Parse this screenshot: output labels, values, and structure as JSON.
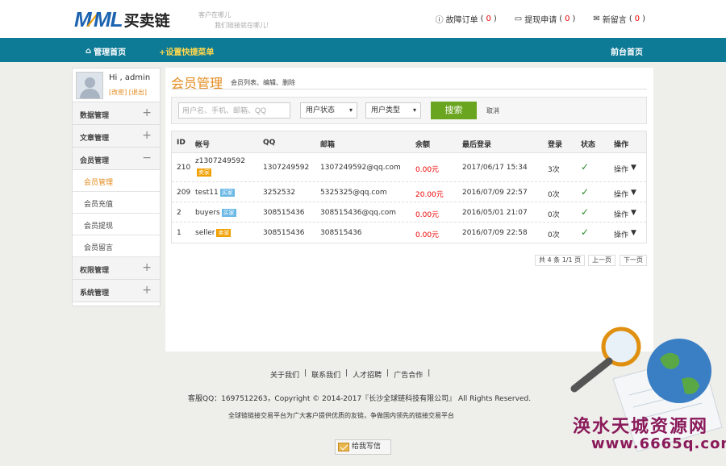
{
  "header": {
    "logo_mark_1": "M",
    "logo_mark_l": "L",
    "logo_mark_2": "ML",
    "logo_text": "买卖链",
    "slogan_line1": "客户在哪儿",
    "slogan_line2": "我们链接就在哪儿!",
    "links": [
      {
        "label": "故障订单",
        "count": "0",
        "icon": "info-icon"
      },
      {
        "label": "提现申请",
        "count": "0",
        "icon": "card-icon"
      },
      {
        "label": "新留言",
        "count": "0",
        "icon": "chat-icon"
      }
    ]
  },
  "nav": {
    "home": "管理首页",
    "quick": "+设置快捷菜单",
    "front": "前台首页"
  },
  "sidebar": {
    "greeting": "Hi , admin",
    "change": "[改密]",
    "logout": "[退出]",
    "sections": [
      {
        "label": "数据管理",
        "sign": "+"
      },
      {
        "label": "文章管理",
        "sign": "+"
      },
      {
        "label": "会员管理",
        "sign": "−"
      },
      {
        "label": "权限管理",
        "sign": "+"
      },
      {
        "label": "系统管理",
        "sign": "+"
      }
    ],
    "subitems": [
      "会员管理",
      "会员充值",
      "会员提现",
      "会员留言"
    ]
  },
  "main": {
    "title": "会员管理",
    "desc": "会员列表、编辑、删除",
    "search": {
      "placeholder": "用户名、手机、邮箱、QQ",
      "status_select": "用户状态",
      "type_select": "用户类型",
      "search_button": "搜索",
      "cancel": "取消"
    },
    "table": {
      "headers": [
        "ID",
        "帐号",
        "QQ",
        "邮箱",
        "余额",
        "最后登录",
        "登录",
        "状态",
        "操作"
      ],
      "rows": [
        {
          "id": "210",
          "account": "z1307249592",
          "tag": "卖家",
          "qq": "1307249592",
          "email": "1307249592@qq.com",
          "balance": "0.00元",
          "last_login": "2017/06/17 15:34",
          "logins": "3次",
          "status": "✓",
          "op": "操作"
        },
        {
          "id": "209",
          "account": "test11",
          "tag": "买家",
          "qq": "3252532",
          "email": "5325325@qq.com",
          "balance": "20.00元",
          "last_login": "2016/07/09 22:57",
          "logins": "0次",
          "status": "✓",
          "op": "操作"
        },
        {
          "id": "2",
          "account": "buyers",
          "tag": "买家",
          "qq": "308515436",
          "email": "308515436@qq.com",
          "balance": "0.00元",
          "last_login": "2016/05/01 21:07",
          "logins": "0次",
          "status": "✓",
          "op": "操作"
        },
        {
          "id": "1",
          "account": "seller",
          "tag": "卖家",
          "qq": "308515436",
          "email": "308515436",
          "balance": "0.00元",
          "last_login": "2016/07/09 22:58",
          "logins": "0次",
          "status": "✓",
          "op": "操作"
        }
      ]
    },
    "pager": {
      "summary": "共 4 条 1/1 页",
      "prev": "上一页",
      "next": "下一页"
    }
  },
  "footer": {
    "links": [
      "关于我们",
      "联系我们",
      "人才招聘",
      "广告合作"
    ],
    "copyright": "客服QQ：1697512263，Copyright © 2014-2017『长沙全球链科技有限公司』 All Rights Reserved.",
    "slogan": "全球链链接交易平台为广大客户提供优质的友链，争做国内领先的链接交易平台",
    "mail_button": "给我写信"
  },
  "watermark": {
    "line1": "涣水天城资源网",
    "line2": "www.6665q.com"
  }
}
